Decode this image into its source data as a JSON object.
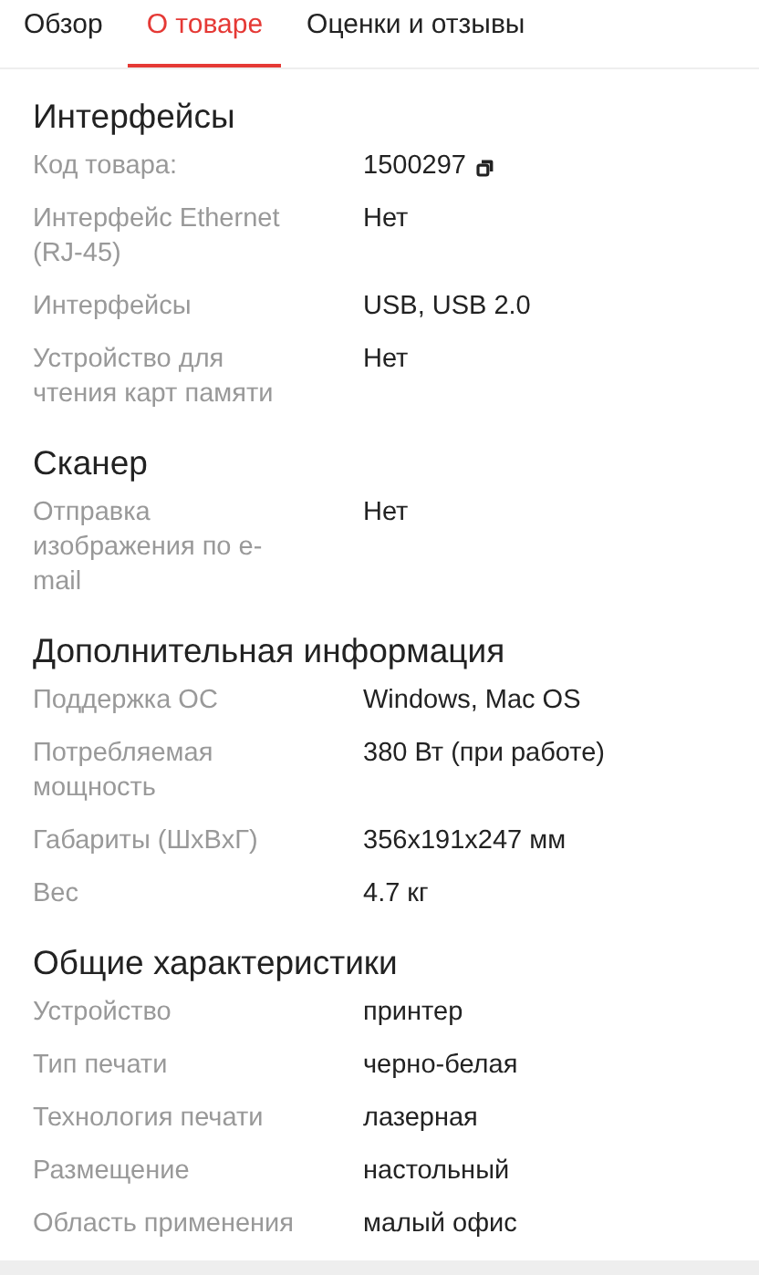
{
  "tabs": [
    {
      "label": "Обзор",
      "selected": false
    },
    {
      "label": "О товаре",
      "selected": true
    },
    {
      "label": "Оценки и отзывы",
      "selected": false
    }
  ],
  "sections": [
    {
      "title": "Интерфейсы",
      "rows": [
        {
          "label": "Код товара:",
          "value": "1500297",
          "copyable": true
        },
        {
          "label": "Интерфейс Ethernet (RJ-45)",
          "value": "Нет",
          "copyable": false
        },
        {
          "label": "Интерфейсы",
          "value": "USB, USB 2.0",
          "copyable": false
        },
        {
          "label": "Устройство для чтения карт памяти",
          "value": "Нет",
          "copyable": false
        }
      ]
    },
    {
      "title": "Сканер",
      "rows": [
        {
          "label": "Отправка изображения по e-mail",
          "value": "Нет",
          "copyable": false
        }
      ]
    },
    {
      "title": "Дополнительная информация",
      "rows": [
        {
          "label": "Поддержка ОС",
          "value": "Windows, Mac OS",
          "copyable": false
        },
        {
          "label": "Потребляемая мощность",
          "value": "380 Вт (при работе)",
          "copyable": false
        },
        {
          "label": "Габариты (ШxВxГ)",
          "value": "356x191x247 мм",
          "copyable": false
        },
        {
          "label": "Вес",
          "value": "4.7 кг",
          "copyable": false
        }
      ]
    },
    {
      "title": "Общие характеристики",
      "rows": [
        {
          "label": "Устройство",
          "value": "принтер",
          "copyable": false
        },
        {
          "label": "Тип печати",
          "value": "черно-белая",
          "copyable": false
        },
        {
          "label": "Технология печати",
          "value": "лазерная",
          "copyable": false
        },
        {
          "label": "Размещение",
          "value": "настольный",
          "copyable": false
        },
        {
          "label": "Область применения",
          "value": "малый офис",
          "copyable": false
        }
      ]
    }
  ]
}
